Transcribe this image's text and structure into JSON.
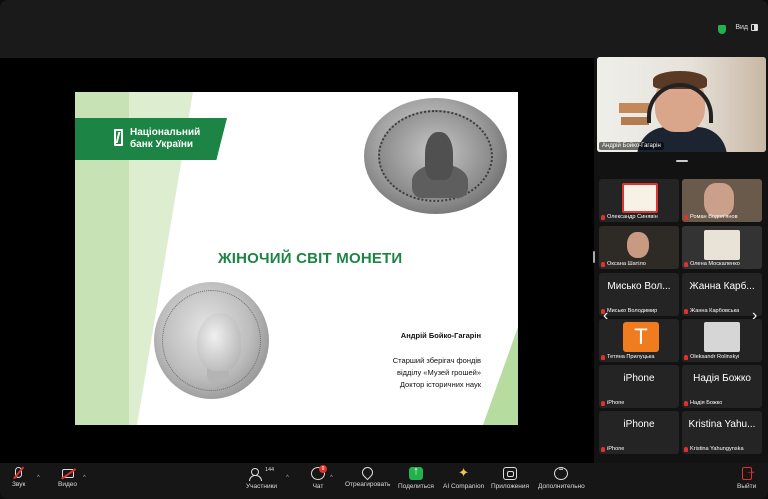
{
  "window": {
    "view_label": "Вид"
  },
  "slide": {
    "brand_line1": "Національний",
    "brand_line2": "банк України",
    "title": "ЖІНОЧИЙ СВІТ МОНЕТИ",
    "author": "Андрій Бойко-Гагарін",
    "role_line1": "Старший зберігач фондів",
    "role_line2": "відділу «Музей грошей»",
    "role_line3": "Доктор історичних наук",
    "colors": {
      "brand_green": "#1c8545",
      "light_green": "#b7dca0"
    }
  },
  "speaker": {
    "name": "Андрій Бойко-Гагарін"
  },
  "participants": [
    {
      "name": "Олександр Синявін",
      "avatar": "logo-icon",
      "muted": true
    },
    {
      "name": "Роман Водоп'янов",
      "avatar": "photo",
      "muted": true
    },
    {
      "name": "Оксана Шатіло",
      "avatar": "photo",
      "muted": true
    },
    {
      "name": "Олена Москаленко",
      "avatar": "photo",
      "muted": true
    },
    {
      "name": "Мисько Володимир",
      "display": "Мисько Вол...",
      "avatar": "text",
      "muted": true
    },
    {
      "name": "Жанна Карбовська",
      "display": "Жанна Карб...",
      "avatar": "text",
      "muted": true
    },
    {
      "name": "Тетяна Прилуцька",
      "avatar": "T",
      "muted": true
    },
    {
      "name": "Oleksandr Rolinskyi",
      "avatar": "photo",
      "muted": true
    },
    {
      "name": "iPhone",
      "display": "iPhone",
      "avatar": "text",
      "muted": true
    },
    {
      "name": "Надія Божко",
      "display": "Надія Божко",
      "avatar": "text",
      "muted": true
    },
    {
      "name": "iPhone",
      "display": "iPhone",
      "avatar": "text",
      "muted": true
    },
    {
      "name": "Kristina Yahungynska",
      "display": "Kristina Yahu...",
      "avatar": "text",
      "muted": true
    }
  ],
  "toolbar": {
    "audio": "Звук",
    "video": "Видео",
    "participants": "Участники",
    "participants_count": "144",
    "chat": "Чат",
    "chat_badge": "9",
    "react": "Отреагировать",
    "share": "Поделиться",
    "ai": "AI Companion",
    "apps": "Приложения",
    "more": "Дополнительно",
    "leave": "Выйти"
  }
}
